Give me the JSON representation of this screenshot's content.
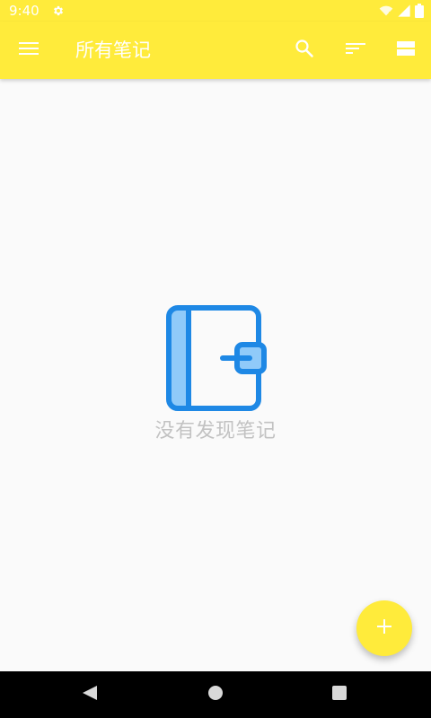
{
  "status_bar": {
    "time": "9:40",
    "settings_icon": "gear-icon",
    "wifi_icon": "wifi-icon",
    "signal_icon": "signal-icon",
    "battery_icon": "battery-icon"
  },
  "app_bar": {
    "title": "所有笔记",
    "menu_icon": "menu-icon",
    "actions": [
      "search-icon",
      "sort-icon",
      "view-toggle-icon"
    ]
  },
  "empty_state": {
    "icon": "notebook-icon",
    "message": "没有发现笔记"
  },
  "fab": {
    "icon": "plus-icon"
  },
  "nav_bar": {
    "buttons": [
      "back-icon",
      "home-icon",
      "recents-icon"
    ]
  },
  "colors": {
    "primary": "#FFEB3B",
    "accent_blue": "#1E88E5",
    "light_blue": "#90CAF9",
    "background": "#FAFAFA",
    "empty_text": "#C2C2C2"
  }
}
